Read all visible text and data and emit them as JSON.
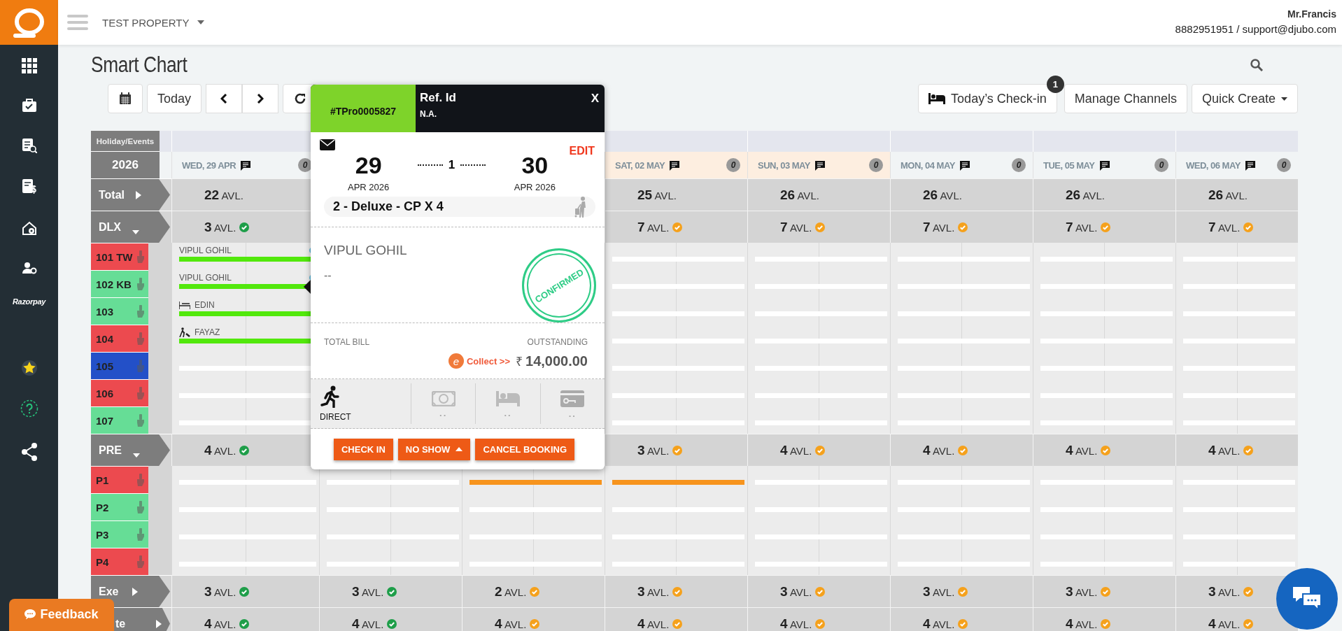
{
  "topbar": {
    "property": "TEST PROPERTY",
    "user_name": "Mr.Francis",
    "user_contact": "8882951951 / support@djubo.com"
  },
  "sidebar": {
    "brand_label": "Razorpay"
  },
  "page": {
    "title": "Smart Chart",
    "today_button": "Today",
    "checkin_button": "Today’s Check-in",
    "checkin_badge": "1",
    "channels_button": "Manage Channels",
    "quick_create_button": "Quick Create"
  },
  "chart": {
    "events_label": "Holiday/Events",
    "year": "2026",
    "days": [
      {
        "label": "WED, 29 APR",
        "note_count": "0",
        "weekend": false
      },
      {
        "label": "SAT, 02 MAY",
        "note_count": "0",
        "weekend": true
      },
      {
        "label": "SUN, 03 MAY",
        "note_count": "0",
        "weekend": true
      },
      {
        "label": "MON, 04 MAY",
        "note_count": "0",
        "weekend": false
      },
      {
        "label": "TUE, 05 MAY",
        "note_count": "0",
        "weekend": false
      },
      {
        "label": "WED, 06 MAY",
        "note_count": "0",
        "weekend": false
      }
    ],
    "rows": [
      {
        "kind": "category",
        "name": "Total",
        "expanded": false,
        "cells": [
          {
            "text": "**22** AVL."
          },
          {
            "text": "**25** AVL."
          },
          {
            "text": "**26** AVL."
          },
          {
            "text": "**26** AVL."
          },
          {
            "text": "**26** AVL."
          },
          {
            "text": "**26** AVL."
          }
        ]
      },
      {
        "kind": "category",
        "name": "DLX",
        "expanded": true,
        "cells": [
          {
            "text": "**3** AVL.",
            "color": "#1e9e49"
          },
          {
            "text": "**7** AVL.",
            "color": "#f5a11c"
          },
          {
            "text": "**7** AVL.",
            "color": "#f5a11c"
          },
          {
            "text": "**7** AVL.",
            "color": "#f5a11c"
          },
          {
            "text": "**7** AVL.",
            "color": "#f5a11c"
          },
          {
            "text": "**7** AVL.",
            "color": "#f5a11c"
          }
        ]
      },
      {
        "kind": "room",
        "name": "101 TW",
        "color": "#ec4a4f",
        "booking": {
          "guest": "VIPUL GOHIL",
          "kind": "linked"
        },
        "lanes": [
          {
            "booked": true,
            "color": "#52e80c"
          },
          {
            "booked": false
          },
          {
            "booked": false
          },
          {
            "booked": false
          },
          {
            "booked": false
          },
          {
            "booked": false
          }
        ]
      },
      {
        "kind": "room",
        "name": "102 KB",
        "color": "#66dd96",
        "booking": {
          "guest": "VIPUL GOHIL",
          "kind": "linked"
        },
        "lanes": [
          {
            "booked": true,
            "color": "#52e80c"
          },
          {
            "booked": false
          },
          {
            "booked": false
          },
          {
            "booked": false
          },
          {
            "booked": false
          },
          {
            "booked": false
          }
        ]
      },
      {
        "kind": "room",
        "name": "103",
        "color": "#66dd96",
        "booking": {
          "guest": "EDIN",
          "kind": "checked_in"
        },
        "lanes": [
          {
            "booked": true,
            "color": "#52e80c"
          },
          {
            "booked": false
          },
          {
            "booked": false
          },
          {
            "booked": false
          },
          {
            "booked": false
          },
          {
            "booked": false
          }
        ]
      },
      {
        "kind": "room",
        "name": "104",
        "color": "#ec4a4f",
        "booking": {
          "guest": "FAYAZ",
          "kind": "arriving"
        },
        "lanes": [
          {
            "booked": true,
            "color": "#52e80c"
          },
          {
            "booked": false
          },
          {
            "booked": false
          },
          {
            "booked": false
          },
          {
            "booked": false
          },
          {
            "booked": false
          }
        ]
      },
      {
        "kind": "room",
        "name": "105",
        "color": "#2350c8",
        "lanes": [
          {
            "booked": false
          },
          {
            "booked": false
          },
          {
            "booked": false
          },
          {
            "booked": false
          },
          {
            "booked": false
          },
          {
            "booked": false
          }
        ]
      },
      {
        "kind": "room",
        "name": "106",
        "color": "#ec4a4f",
        "lanes": [
          {
            "booked": false
          },
          {
            "booked": false
          },
          {
            "booked": false
          },
          {
            "booked": false
          },
          {
            "booked": false
          },
          {
            "booked": false
          }
        ]
      },
      {
        "kind": "room",
        "name": "107",
        "color": "#66dd96",
        "lanes": [
          {
            "booked": false
          },
          {
            "booked": false
          },
          {
            "booked": false
          },
          {
            "booked": false
          },
          {
            "booked": false
          },
          {
            "booked": false
          }
        ]
      },
      {
        "kind": "category",
        "name": "PRE",
        "expanded": true,
        "cells": [
          {
            "text": "**4** AVL.",
            "color": "#1e9e49"
          },
          {
            "text": "**3** AVL.",
            "color": "#f5a11c"
          },
          {
            "text": "**4** AVL.",
            "color": "#f5a11c"
          },
          {
            "text": "**4** AVL.",
            "color": "#f5a11c"
          },
          {
            "text": "**4** AVL.",
            "color": "#f5a11c"
          },
          {
            "text": "**4** AVL.",
            "color": "#f5a11c"
          }
        ]
      },
      {
        "kind": "room",
        "name": "P1",
        "color": "#ec4a4f",
        "lanes": [
          {
            "booked": false
          },
          {
            "booked": false
          },
          {
            "booked": true,
            "color": "#f7941d"
          },
          {
            "booked": true,
            "color": "#f7941d"
          },
          {
            "booked": false
          },
          {
            "booked": false
          },
          {
            "booked": false
          },
          {
            "booked": false
          }
        ]
      },
      {
        "kind": "room",
        "name": "P2",
        "color": "#66dd96",
        "lanes": [
          {
            "booked": false
          },
          {
            "booked": false
          },
          {
            "booked": false
          },
          {
            "booked": false
          },
          {
            "booked": false
          },
          {
            "booked": false
          },
          {
            "booked": false
          },
          {
            "booked": false
          }
        ]
      },
      {
        "kind": "room",
        "name": "P3",
        "color": "#66dd96",
        "lanes": [
          {
            "booked": false
          },
          {
            "booked": false
          },
          {
            "booked": false
          },
          {
            "booked": false
          },
          {
            "booked": false
          },
          {
            "booked": false
          },
          {
            "booked": false
          },
          {
            "booked": false
          }
        ]
      },
      {
        "kind": "room",
        "name": "P4",
        "color": "#ec4a4f",
        "lanes": [
          {
            "booked": false
          },
          {
            "booked": false
          },
          {
            "booked": false
          },
          {
            "booked": false
          },
          {
            "booked": false
          },
          {
            "booked": false
          },
          {
            "booked": false
          },
          {
            "booked": false
          }
        ]
      },
      {
        "kind": "category",
        "name": "Exe",
        "expanded": false,
        "cells": [
          {
            "text": "**3** AVL.",
            "color": "#1e9e49"
          },
          {
            "text": "**3** AVL.",
            "color": "#1e9e49"
          },
          {
            "text": "**2** AVL.",
            "color": "#f5a11c"
          },
          {
            "text": "**3** AVL.",
            "color": "#f5a11c"
          },
          {
            "text": "**3** AVL.",
            "color": "#f5a11c"
          },
          {
            "text": "**3** AVL.",
            "color": "#f5a11c"
          },
          {
            "text": "**3** AVL.",
            "color": "#f5a11c"
          },
          {
            "text": "**3** AVL.",
            "color": "#f5a11c"
          }
        ]
      },
      {
        "kind": "category",
        "name": "te",
        "expanded": false,
        "cut": true,
        "cells": [
          {
            "text": "**4** AVL.",
            "color": "#1e9e49"
          },
          {
            "text": "**4** AVL.",
            "color": "#1e9e49"
          },
          {
            "text": "**4** AVL.",
            "color": "#f5a11c"
          },
          {
            "text": "**4** AVL.",
            "color": "#f5a11c"
          },
          {
            "text": "**4** AVL.",
            "color": "#f5a11c"
          },
          {
            "text": "**4** AVL.",
            "color": "#f5a11c"
          },
          {
            "text": "**4** AVL.",
            "color": "#f5a11c"
          },
          {
            "text": "**4** AVL.",
            "color": "#f5a11c"
          }
        ]
      }
    ]
  },
  "booking_popup": {
    "booking_id": "#TPro0005827",
    "ref_label": "Ref. Id",
    "ref_value": "N.A.",
    "close": "X",
    "edit": "EDIT",
    "checkin_day": "29",
    "checkin_month": "APR 2026",
    "nights": "1",
    "checkout_day": "30",
    "checkout_month": "APR 2026",
    "room_summary": "2 - Deluxe - CP X 4",
    "guest": "VIPUL GOHIL",
    "guest_detail": "--",
    "stamp": "CONFIRMED",
    "total_label": "TOTAL BILL",
    "outstanding_label": "OUTSTANDING",
    "collect_badge": "e",
    "collect": "Collect >>",
    "currency": "₹",
    "amount": "14,000.00",
    "source": "DIRECT",
    "slots": [
      "..",
      "..",
      ".."
    ],
    "buttons": [
      {
        "label": "CHECK IN",
        "kind": "plain"
      },
      {
        "label": "NO SHOW",
        "kind": "menu"
      },
      {
        "label": "CANCEL BOOKING",
        "kind": "plain"
      }
    ]
  },
  "feedback": {
    "label": "Feedback"
  }
}
